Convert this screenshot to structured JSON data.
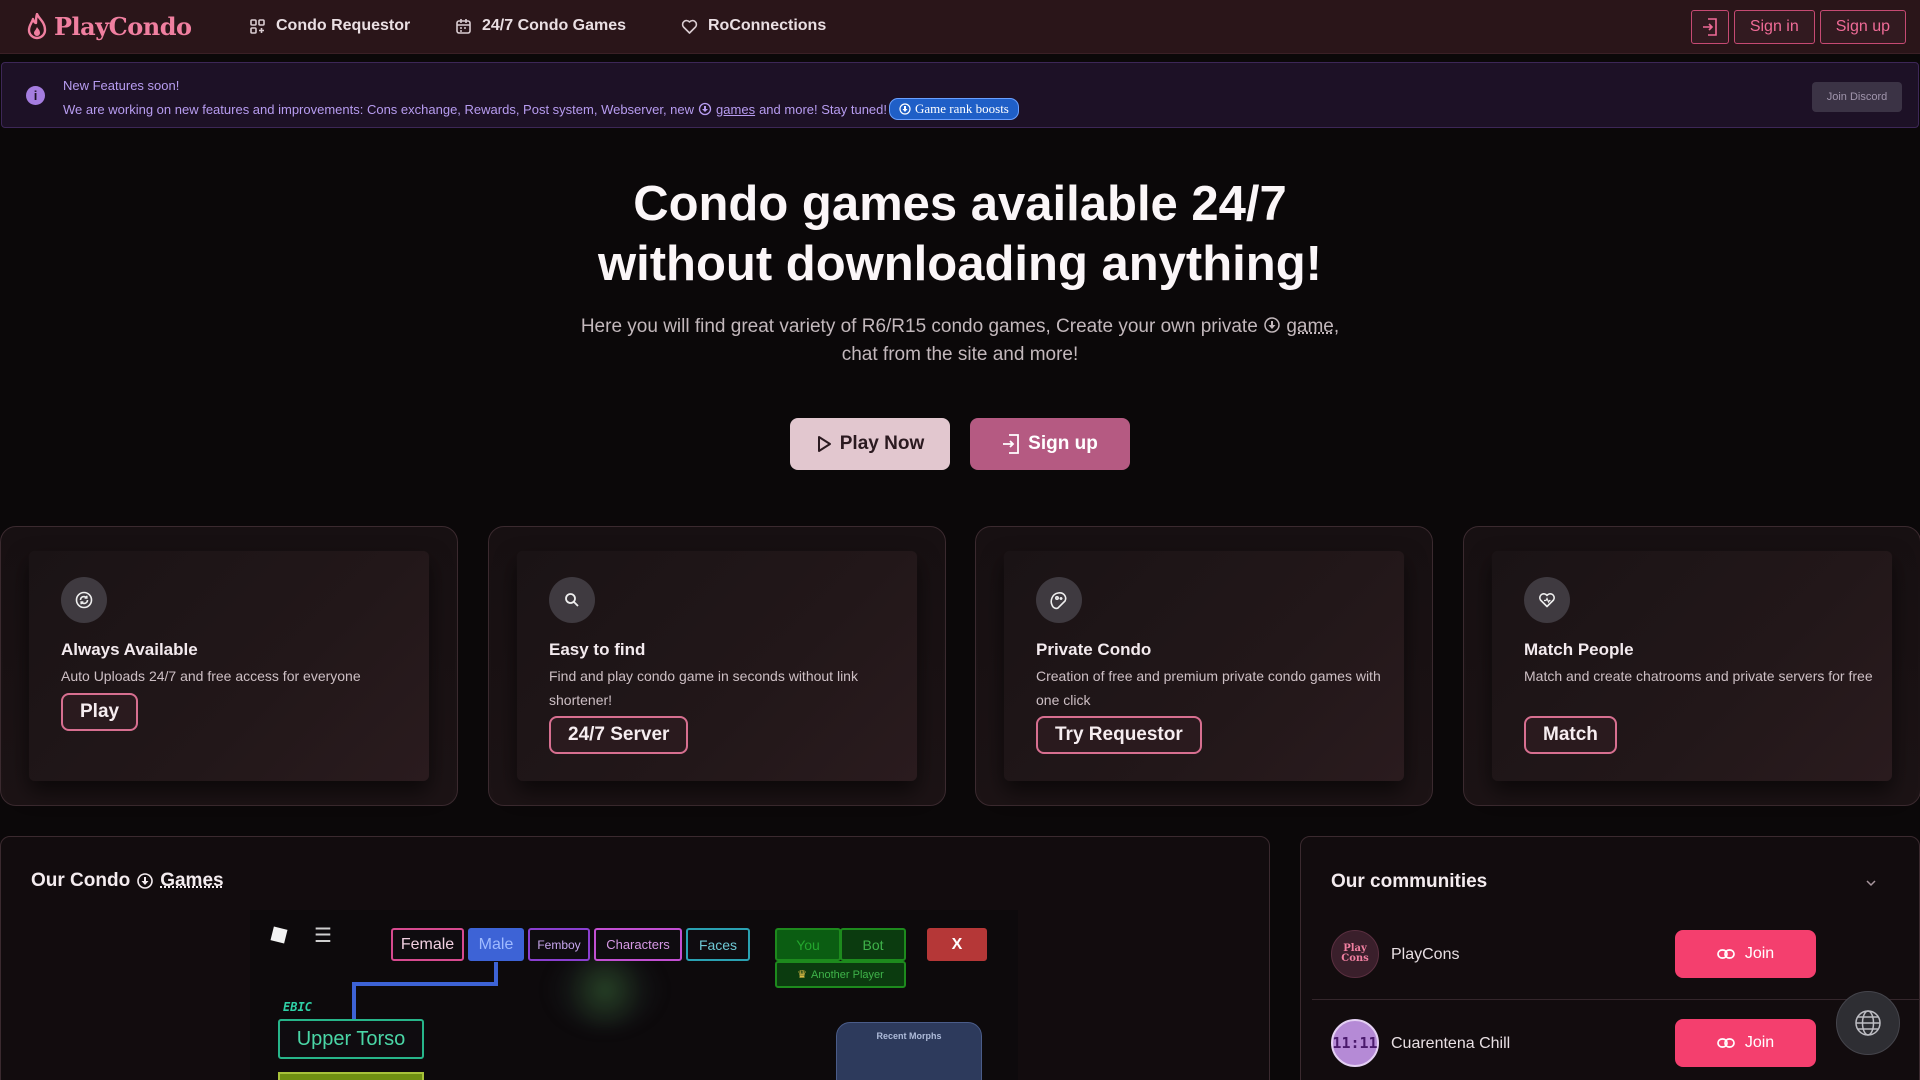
{
  "nav": {
    "logo_text": "PlayCondo",
    "links": [
      {
        "label": "Condo Requestor",
        "icon": "grid-icon"
      },
      {
        "label": "24/7 Condo Games",
        "icon": "calendar-icon"
      },
      {
        "label": "RoConnections",
        "icon": "heart-icon"
      }
    ],
    "sign_in": "Sign in",
    "sign_up": "Sign up"
  },
  "banner": {
    "title": "New Features soon!",
    "text_before": "We are working on new features and improvements: Cons exchange, Rewards, Post system, Webserver, new",
    "link": "games",
    "text_after": "and more! Stay tuned!",
    "pill": "Game rank boosts",
    "discord": "Join Discord"
  },
  "hero": {
    "title_line1": "Condo games available 24/7",
    "title_line2": "without downloading anything!",
    "sub_before": "Here you will find great variety of R6/R15 condo games, Create your own private",
    "sub_link": "game",
    "sub_after": ",",
    "sub_line2": "chat from the site and more!",
    "play_now": "Play Now",
    "sign_up": "Sign up"
  },
  "features": [
    {
      "title": "Always Available",
      "desc": "Auto Uploads 24/7 and free access for everyone",
      "button": "Play",
      "icon": "refresh-icon"
    },
    {
      "title": "Easy to find",
      "desc": "Find and play condo game in seconds without link shortener!",
      "button": "24/7 Server",
      "icon": "search-icon"
    },
    {
      "title": "Private Condo",
      "desc": "Creation of free and premium private condo games with one click",
      "button": "Try Requestor",
      "icon": "gamepad-icon"
    },
    {
      "title": "Match People",
      "desc": "Match and create chatrooms and private servers for free",
      "button": "Match",
      "icon": "heart-icon"
    }
  ],
  "games": {
    "title_before": "Our Condo",
    "title_link": "Games",
    "preview": {
      "female": "Female",
      "male": "Male",
      "femboy": "Femboy",
      "characters": "Characters",
      "faces": "Faces",
      "you": "You",
      "bot": "Bot",
      "another_player": "Another Player",
      "close": "X",
      "ebic": "EBIC",
      "upper_torso": "Upper Torso",
      "recent_morphs": "Recent Morphs"
    }
  },
  "communities": {
    "title": "Our communities",
    "items": [
      {
        "name": "PlayCons",
        "join": "Join"
      },
      {
        "name": "Cuarentena Chill",
        "join": "Join"
      }
    ]
  },
  "colors": {
    "accent": "#f43f6e",
    "nav_bg": "#2a1519",
    "banner_text": "#b79cf0"
  }
}
